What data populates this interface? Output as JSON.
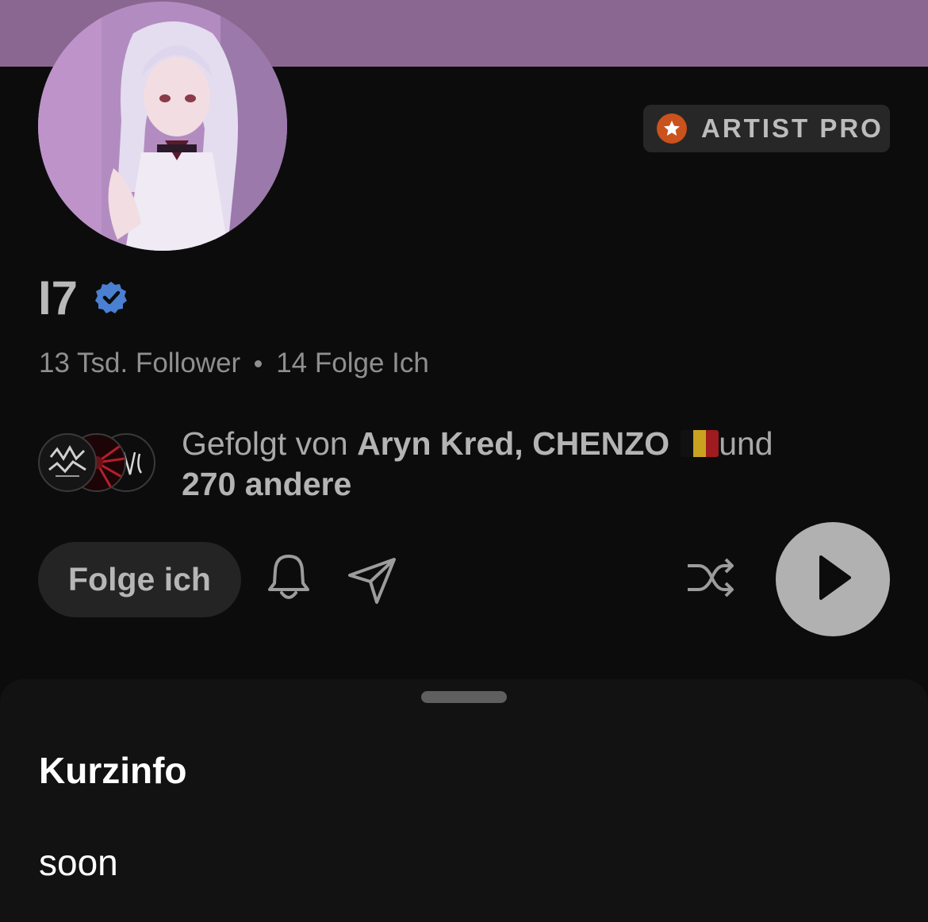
{
  "profile": {
    "name": "I7",
    "badge_label": "ARTIST PRO",
    "followers": "13 Tsd. Follower",
    "following": "14 Folge Ich"
  },
  "followed_by": {
    "prefix": "Gefolgt von ",
    "names": "Aryn Kred, CHENZO",
    "connector": "und",
    "others": "270 andere"
  },
  "actions": {
    "follow_label": "Folge ich"
  },
  "info_sheet": {
    "title": "Kurzinfo",
    "text": "soon"
  },
  "colors": {
    "banner": "#8a6791",
    "background": "#0c0c0c",
    "sheet": "#121212",
    "pro_star": "#c9521d",
    "verified": "#4b7fd1"
  },
  "icons": [
    "star-icon",
    "verified-icon",
    "bell-icon",
    "share-icon",
    "shuffle-icon",
    "play-icon"
  ]
}
